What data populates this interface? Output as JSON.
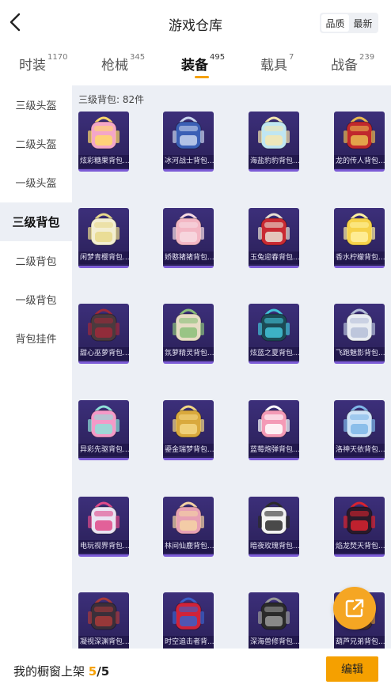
{
  "header": {
    "title": "游戏仓库",
    "sort_options": [
      "品质",
      "最新"
    ],
    "sort_selected": "品质"
  },
  "tabs": [
    {
      "label": "时装",
      "count": "1170"
    },
    {
      "label": "枪械",
      "count": "345"
    },
    {
      "label": "装备",
      "count": "495",
      "active": true
    },
    {
      "label": "载具",
      "count": "7"
    },
    {
      "label": "战备",
      "count": "239"
    }
  ],
  "sidebar": {
    "items": [
      {
        "label": "三级头盔"
      },
      {
        "label": "二级头盔"
      },
      {
        "label": "一级头盔"
      },
      {
        "label": "三级背包",
        "active": true
      },
      {
        "label": "二级背包"
      },
      {
        "label": "一级背包"
      },
      {
        "label": "背包挂件"
      }
    ]
  },
  "content": {
    "section_title": "三级背包: 82件",
    "items": [
      {
        "name": "炫彩糖果背包...",
        "colors": [
          "#f4a6c8",
          "#ffd86b"
        ]
      },
      {
        "name": "冰河战士背包...",
        "colors": [
          "#3b5fb5",
          "#c8d4ee"
        ]
      },
      {
        "name": "海盐豹豹背包...",
        "colors": [
          "#bfe6f2",
          "#f4e6b0"
        ]
      },
      {
        "name": "龙的传人背包...",
        "colors": [
          "#c0282d",
          "#e8b850"
        ]
      },
      {
        "name": "闲梦青樱背包...",
        "colors": [
          "#f3eed2",
          "#e7d98c"
        ]
      },
      {
        "name": "娇憨猪猪背包...",
        "colors": [
          "#f3b7c4",
          "#f7dbe2"
        ]
      },
      {
        "name": "玉兔迎春背包...",
        "colors": [
          "#c92a32",
          "#e9e1d3"
        ]
      },
      {
        "name": "香水柠檬背包...",
        "colors": [
          "#f6d24a",
          "#fff1a0"
        ]
      },
      {
        "name": "甜心巫萝背包...",
        "colors": [
          "#4a3a3e",
          "#9e2a3a"
        ]
      },
      {
        "name": "氛萝精灵背包...",
        "colors": [
          "#e6dcc4",
          "#8bbf7a"
        ]
      },
      {
        "name": "炫蓝之夏背包...",
        "colors": [
          "#1c4a55",
          "#43c3d9"
        ]
      },
      {
        "name": "飞跑魅影背包...",
        "colors": [
          "#e8ecf2",
          "#b5bfd8"
        ]
      },
      {
        "name": "异彩先驱背包...",
        "colors": [
          "#f49ac8",
          "#8fe0d8"
        ]
      },
      {
        "name": "鎏金瑞梦背包...",
        "colors": [
          "#d9a93d",
          "#f3d784"
        ]
      },
      {
        "name": "蓝莓炮弹背包...",
        "colors": [
          "#f49ab6",
          "#ffffff"
        ]
      },
      {
        "name": "洛神天依背包...",
        "colors": [
          "#cfe3f7",
          "#7fb7e8"
        ]
      },
      {
        "name": "电玩视界背包...",
        "colors": [
          "#e9e3f2",
          "#e04a8a"
        ]
      },
      {
        "name": "林间仙鹿背包...",
        "colors": [
          "#e7a0b4",
          "#f5d3a4"
        ]
      },
      {
        "name": "暗夜玫瑰背包...",
        "colors": [
          "#f2f2f2",
          "#2b2b2b"
        ]
      },
      {
        "name": "焰龙焚天背包...",
        "colors": [
          "#2a1a2a",
          "#d9232f"
        ]
      },
      {
        "name": "凝视深渊背包...",
        "colors": [
          "#3a2f3a",
          "#a83a3a"
        ]
      },
      {
        "name": "时空追击者背...",
        "colors": [
          "#d0233a",
          "#3a5fc9"
        ]
      },
      {
        "name": "深海兽修背包...",
        "colors": [
          "#2a2a2a",
          "#9a9a9a"
        ]
      },
      {
        "name": "葫芦兄弟背包...",
        "colors": [
          "#4a2f2a",
          "#c88a3a"
        ]
      }
    ]
  },
  "bottom_bar": {
    "shelf_label": "我的橱窗上架",
    "shelf_count": "5",
    "shelf_total": "/5",
    "edit_label": "编辑"
  },
  "colors": {
    "accent": "#f5a000",
    "content_bg": "#eceff5",
    "card_bg": "#2d2260",
    "card_border": "#7c5cd6"
  },
  "icons": {
    "back": "chevron-left-icon",
    "fab": "share-external-icon"
  }
}
